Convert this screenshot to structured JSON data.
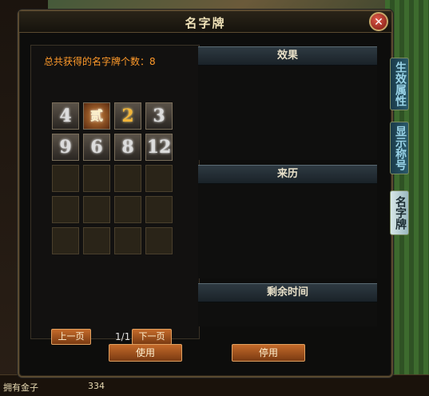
{
  "window": {
    "title": "名字牌",
    "close_symbol": "✕"
  },
  "left_panel": {
    "total_label": "总共获得的名字牌个数：8"
  },
  "title_cards": [
    {
      "glyph": "4",
      "style": "silver"
    },
    {
      "glyph": "贰",
      "style": "ornate"
    },
    {
      "glyph": "2",
      "style": "gold"
    },
    {
      "glyph": "3",
      "style": "silver"
    },
    {
      "glyph": "9",
      "style": "silver"
    },
    {
      "glyph": "6",
      "style": "silver"
    },
    {
      "glyph": "8",
      "style": "silver"
    },
    {
      "glyph": "12",
      "style": "silver"
    }
  ],
  "pager": {
    "prev_label": "上一页",
    "page_text": "1/1",
    "next_label": "下一页"
  },
  "sections": {
    "effect": "效果",
    "origin": "来历",
    "remaining_time": "剩余时间"
  },
  "actions": {
    "use_label": "使用",
    "stop_label": "停用"
  },
  "side_tabs": [
    {
      "label": "生效属性",
      "active": false
    },
    {
      "label": "显示称号",
      "active": false
    },
    {
      "label": "名字牌",
      "active": true
    }
  ],
  "background": {
    "gold_label": "拥有金子",
    "gold_value": "334"
  },
  "colors": {
    "accent_orange": "#ff9a2a",
    "button": "#c46a2a",
    "panel_bg": "#0d0d0c"
  }
}
